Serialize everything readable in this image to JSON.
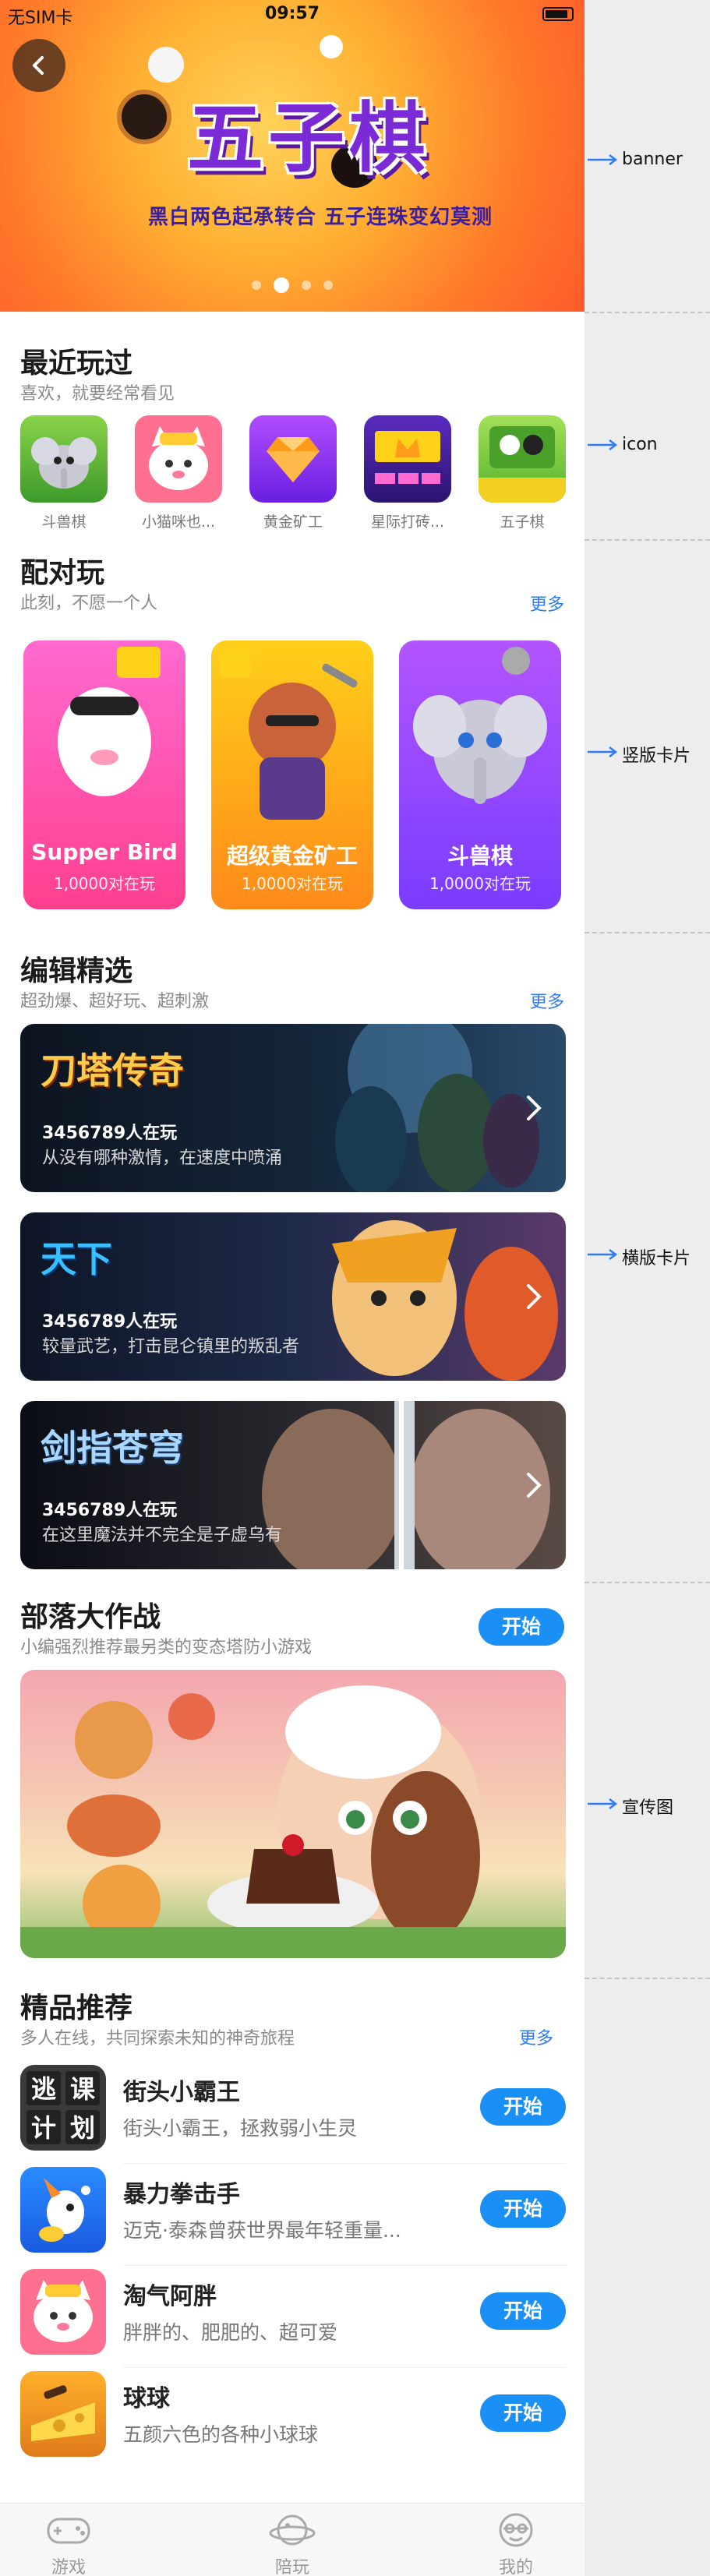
{
  "status_bar": {
    "carrier": "无SIM卡",
    "time": "09:57"
  },
  "banner": {
    "title": "五子棋",
    "subtitle": "黑白两色起承转合  五子连珠变幻莫测",
    "page_count": 4,
    "active_page": 2
  },
  "recent": {
    "title": "最近玩过",
    "subtitle": "喜欢，就要经常看见",
    "items": [
      {
        "label": "斗兽棋",
        "icon": "elephant-icon"
      },
      {
        "label": "小猫咪也...",
        "icon": "cat-icon"
      },
      {
        "label": "黄金矿工",
        "icon": "gem-icon"
      },
      {
        "label": "星际打砖...",
        "icon": "crown-brick-icon"
      },
      {
        "label": "五子棋",
        "icon": "gobang-icon"
      }
    ]
  },
  "pair": {
    "title": "配对玩",
    "subtitle": "此刻，不愿一个人",
    "more": "更多",
    "cards": [
      {
        "title": "Supper Bird",
        "players": "1,0000对在玩",
        "color_top": "#ff6ad0",
        "color_bottom": "#ff3f8e"
      },
      {
        "title": "超级黄金矿工",
        "players": "1,0000对在玩",
        "color_top": "#ffcf1a",
        "color_bottom": "#ff8a1a"
      },
      {
        "title": "斗兽棋",
        "players": "1,0000对在玩",
        "color_top": "#b255ff",
        "color_bottom": "#7a3cff"
      }
    ]
  },
  "editor": {
    "title": "编辑精选",
    "subtitle": "超劲爆、超好玩、超刺激",
    "more": "更多",
    "cards": [
      {
        "logo": "刀塔传奇",
        "players": "3456789人在玩",
        "desc": "从没有哪种激情，在速度中喷涌"
      },
      {
        "logo": "天下",
        "players": "3456789人在玩",
        "desc": "较量武艺，打击昆仑镇里的叛乱者"
      },
      {
        "logo": "剑指苍穹",
        "players": "3456789人在玩",
        "desc": "在这里魔法并不完全是子虚乌有"
      }
    ]
  },
  "tribe": {
    "title": "部落大作战",
    "subtitle": "小编强烈推荐最另类的变态塔防小游戏",
    "start": "开始"
  },
  "featured": {
    "title": "精品推荐",
    "subtitle": "多人在线，共同探索未知的神奇旅程",
    "more": "更多",
    "items": [
      {
        "title": "街头小霸王",
        "desc": "街头小霸王，拯救弱小生灵",
        "start": "开始",
        "icon": "escape-plan-icon",
        "icon_text": "逃课计划"
      },
      {
        "title": "暴力拳击手",
        "desc": "迈克·泰森曾获世界最年轻重量...",
        "start": "开始",
        "icon": "rocket-fox-icon"
      },
      {
        "title": "淘气阿胖",
        "desc": "胖胖的、肥肥的、超可爱",
        "start": "开始",
        "icon": "cat-icon"
      },
      {
        "title": "球球",
        "desc": "五颜六色的各种小球球",
        "start": "开始",
        "icon": "cheese-ball-icon"
      }
    ]
  },
  "tabbar": {
    "tabs": [
      {
        "label": "游戏",
        "icon": "gamepad-icon"
      },
      {
        "label": "陪玩",
        "icon": "planet-icon"
      },
      {
        "label": "我的",
        "icon": "profile-icon"
      }
    ]
  },
  "annotations": {
    "banner": "banner",
    "icon": "icon",
    "vertical_card": "竖版卡片",
    "horizontal_card": "横版卡片",
    "promo": "宣传图"
  }
}
